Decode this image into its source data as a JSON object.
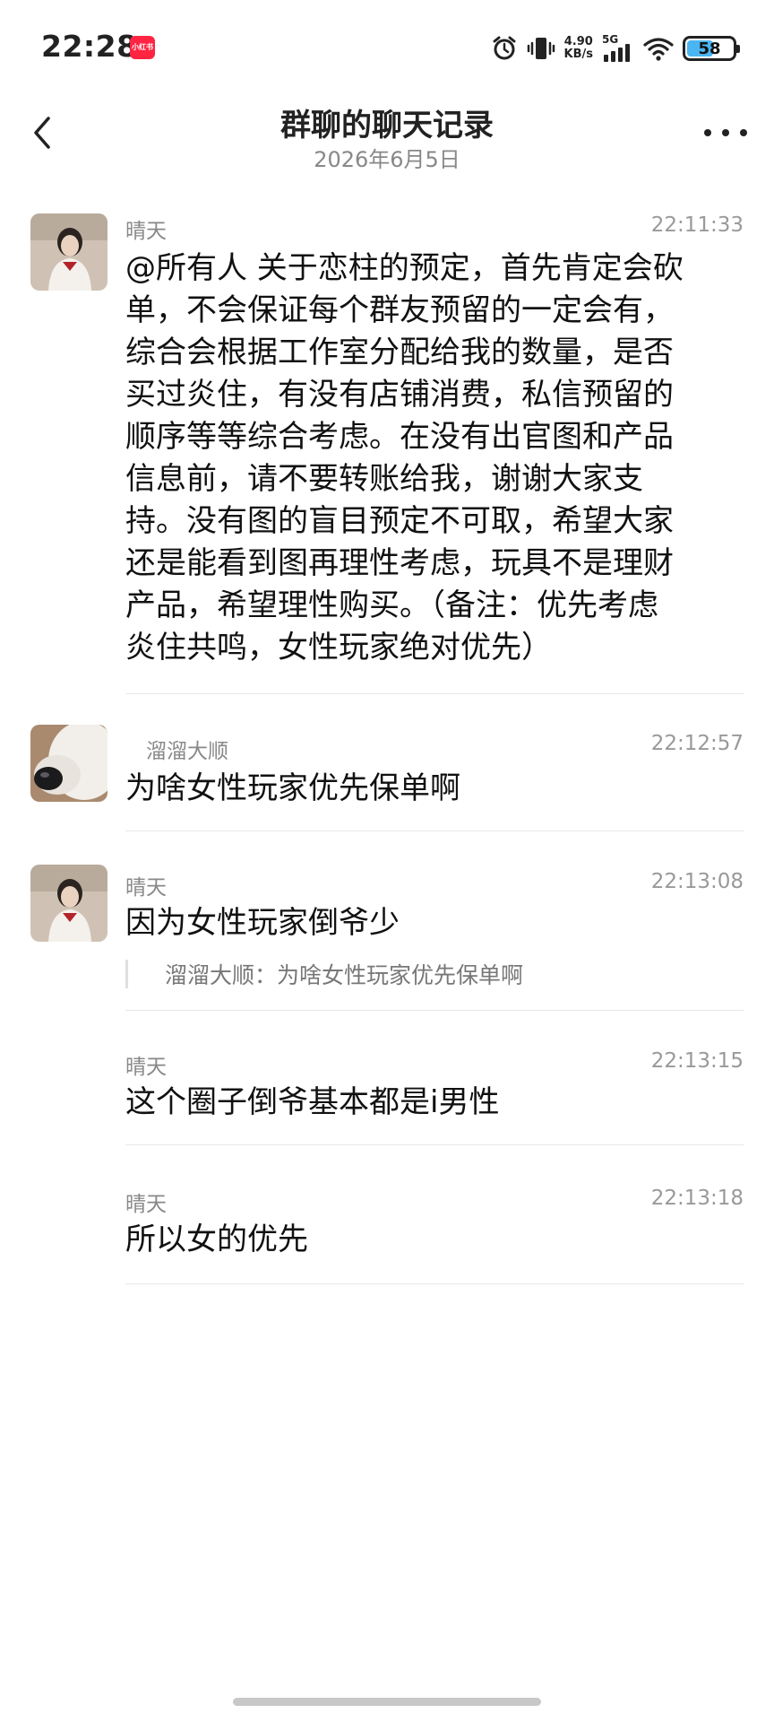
{
  "status_bar": {
    "time": "22:28",
    "app_badge": "小红书",
    "net_speed_value": "4.90",
    "net_speed_unit": "KB/s",
    "network": "5G",
    "battery": "58",
    "battery_level": 0.58,
    "icons": [
      "alarm-icon",
      "vibrate-icon",
      "signal-icon",
      "wifi-icon",
      "battery-icon"
    ]
  },
  "header": {
    "title": "群聊的聊天记录",
    "date": "2026年6月5日"
  },
  "messages": [
    {
      "sender": "晴天",
      "time": "22:11:33",
      "lines": [
        "@所有人 关于恋柱的预定，首先肯定会砍",
        "单，不会保证每个群友预留的一定会有，",
        "综合会根据工作室分配给我的数量，是否",
        "买过炎住，有没有店铺消费，私信预留的",
        "顺序等等综合考虑。在没有出官图和产品",
        "信息前，请不要转账给我，谢谢大家支",
        "持。没有图的盲目预定不可取，希望大家",
        "还是能看到图再理性考虑，玩具不是理财",
        "产品，希望理性购买。（备注：优先考虑",
        "炎住共鸣，女性玩家绝对优先）"
      ]
    },
    {
      "sender": "溜溜大顺",
      "time": "22:12:57",
      "lines": [
        "为啥女性玩家优先保单啊"
      ]
    },
    {
      "sender": "晴天",
      "time": "22:13:08",
      "lines": [
        "因为女性玩家倒爷少"
      ],
      "quote": "溜溜大顺：为啥女性玩家优先保单啊"
    },
    {
      "sender": "晴天",
      "time": "22:13:15",
      "lines": [
        "这个圈子倒爷基本都是i男性"
      ]
    },
    {
      "sender": "晴天",
      "time": "22:13:18",
      "lines": [
        "所以女的优先"
      ]
    }
  ],
  "colors": {
    "brand_red": "#ff2442",
    "battery_fill": "#4ab5f2",
    "meta_gray": "#888888"
  }
}
